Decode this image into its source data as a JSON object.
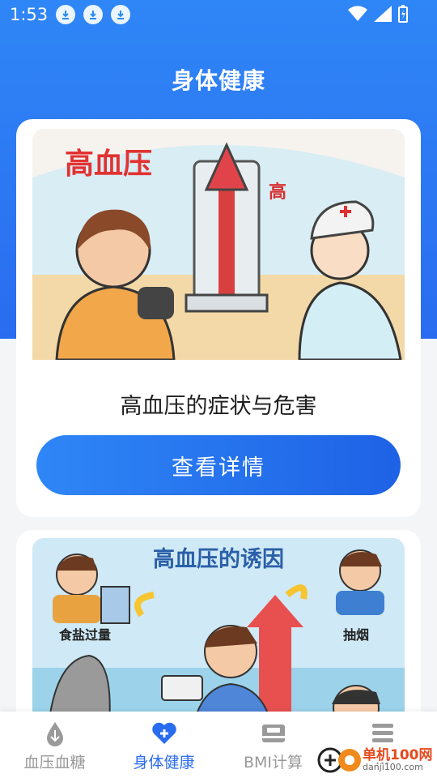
{
  "status_bar": {
    "time": "1:53",
    "download_icons": [
      "download-icon",
      "download-icon",
      "download-icon"
    ]
  },
  "header": {
    "title": "身体健康"
  },
  "cards": [
    {
      "illustration": {
        "title_art": "高血压",
        "side_text": "高"
      },
      "title": "高血压的症状与危害",
      "button_label": "查看详情"
    },
    {
      "illustration": {
        "heading": "高血压的诱因",
        "labels": [
          "食盐过量",
          "抽烟"
        ]
      }
    }
  ],
  "tabbar": {
    "items": [
      {
        "label": "血压血糖",
        "icon": "drop-icon",
        "active": false
      },
      {
        "label": "身体健康",
        "icon": "heart-plus-icon",
        "active": true
      },
      {
        "label": "BMI计算",
        "icon": "scale-icon",
        "active": false
      },
      {
        "label": "...",
        "icon": "menu-icon",
        "active": false
      }
    ]
  },
  "watermark": {
    "text": "单机100网",
    "url": "danji100.com"
  },
  "colors": {
    "primary": "#2a6cf0",
    "inactive": "#999999"
  }
}
